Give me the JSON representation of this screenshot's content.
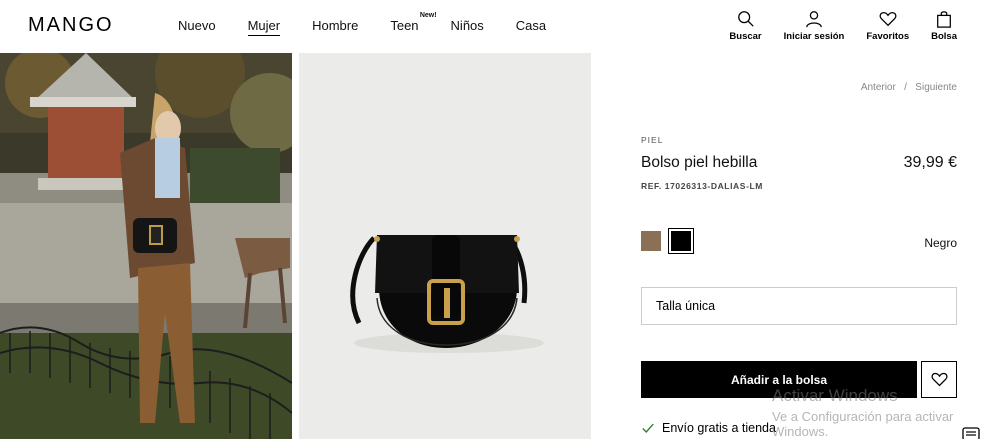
{
  "header": {
    "logo": "MANGO",
    "nav": [
      {
        "label": "Nuevo",
        "badge": ""
      },
      {
        "label": "Mujer",
        "badge": ""
      },
      {
        "label": "Hombre",
        "badge": ""
      },
      {
        "label": "Teen",
        "badge": "New!"
      },
      {
        "label": "Niños",
        "badge": ""
      },
      {
        "label": "Casa",
        "badge": ""
      }
    ],
    "actions": [
      {
        "label": "Buscar",
        "icon": "search-icon"
      },
      {
        "label": "Iniciar sesión",
        "icon": "user-icon"
      },
      {
        "label": "Favoritos",
        "icon": "heart-icon"
      },
      {
        "label": "Bolsa",
        "icon": "bag-icon"
      }
    ]
  },
  "product": {
    "pager": {
      "prev": "Anterior",
      "sep": "/",
      "next": "Siguiente"
    },
    "material": "PIEL",
    "title": "Bolso piel hebilla",
    "price": "39,99 €",
    "ref": "REF. 17026313-DALIAS-LM",
    "colors": [
      {
        "name": "brown",
        "hex": "#8a7155"
      },
      {
        "name": "black",
        "hex": "#000000"
      }
    ],
    "selected_color": "Negro",
    "size": "Talla única",
    "add_to_bag": "Añadir a la bolsa",
    "shipping": "Envío gratis a tienda"
  },
  "watermark": {
    "line1": "Activar Windows",
    "line2": "Ve a Configuración para activar",
    "line3": "Windows."
  },
  "colors": {
    "accent": "#000000",
    "image_bg": "#ebebe9"
  }
}
